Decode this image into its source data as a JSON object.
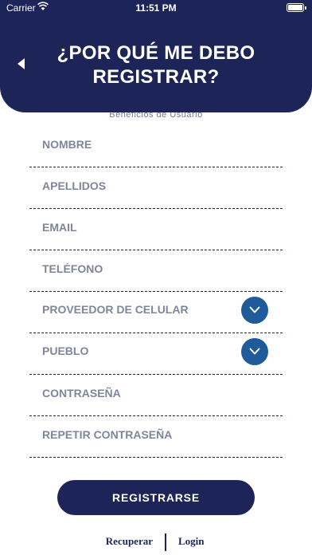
{
  "status_bar": {
    "carrier": "Carrier",
    "time": "11:51 PM",
    "battery_level": 1.0
  },
  "header": {
    "title_line1": "¿POR QUÉ ME DEBO",
    "title_line2": "REGISTRAR?",
    "background": "#1d2458"
  },
  "subtitle": "Beneficios de Usuario",
  "form": {
    "fields": [
      {
        "placeholder": "NOMBRE",
        "value": ""
      },
      {
        "placeholder": "APELLIDOS",
        "value": ""
      },
      {
        "placeholder": "EMAIL",
        "value": ""
      },
      {
        "placeholder": "TELÉFONO",
        "value": ""
      },
      {
        "label": "PROVEEDOR DE CELULAR",
        "type": "dropdown"
      },
      {
        "label": "PUEBLO",
        "type": "dropdown"
      },
      {
        "placeholder": "CONTRASEÑA",
        "value": ""
      },
      {
        "placeholder": "REPETIR CONTRASEÑA",
        "value": ""
      }
    ],
    "dropdown_color": "#1f5a9b"
  },
  "register_label": "REGISTRARSE",
  "footer": {
    "recover_label": "Recuperar",
    "login_label": "Login"
  },
  "icons": {
    "back": "chevron-left-icon",
    "dropdown": "chevron-down-icon",
    "wifi": "wifi-icon",
    "battery": "battery-icon"
  }
}
